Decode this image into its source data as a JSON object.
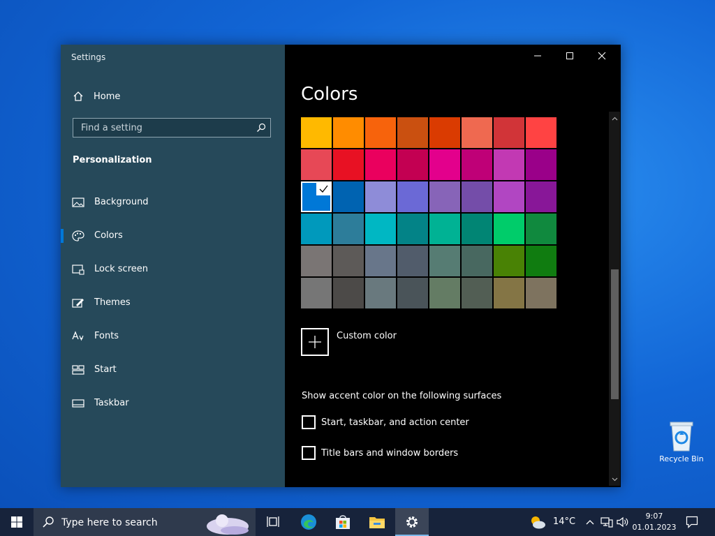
{
  "window": {
    "app_title": "Settings",
    "controls": {
      "minimize": "minimize",
      "maximize": "maximize",
      "close": "close"
    }
  },
  "sidebar": {
    "home_label": "Home",
    "search_placeholder": "Find a setting",
    "section_title": "Personalization",
    "items": [
      {
        "label": "Background",
        "icon": "picture-icon",
        "active": false
      },
      {
        "label": "Colors",
        "icon": "palette-icon",
        "active": true
      },
      {
        "label": "Lock screen",
        "icon": "lock-screen-icon",
        "active": false
      },
      {
        "label": "Themes",
        "icon": "themes-icon",
        "active": false
      },
      {
        "label": "Fonts",
        "icon": "fonts-icon",
        "active": false
      },
      {
        "label": "Start",
        "icon": "start-icon",
        "active": false
      },
      {
        "label": "Taskbar",
        "icon": "taskbar-icon",
        "active": false
      }
    ]
  },
  "main": {
    "title": "Colors",
    "selected_color": "#0078d7",
    "color_rows": [
      [
        "#ffb900",
        "#ff8c00",
        "#f7630c",
        "#ca5010",
        "#da3b01",
        "#ef6950",
        "#d13438",
        "#ff4343"
      ],
      [
        "#e74856",
        "#e81123",
        "#ea005e",
        "#c30052",
        "#e3008c",
        "#bf0077",
        "#c239b3",
        "#9a0089"
      ],
      [
        "#0078d7",
        "#0063b1",
        "#8e8cd8",
        "#6b69d6",
        "#8764b8",
        "#744da9",
        "#b146c2",
        "#881798"
      ],
      [
        "#0099bc",
        "#2d7d9a",
        "#00b7c3",
        "#038387",
        "#00b294",
        "#018574",
        "#00cc6a",
        "#10893e"
      ],
      [
        "#7a7574",
        "#5d5a58",
        "#68768a",
        "#515c6b",
        "#567c73",
        "#486860",
        "#498205",
        "#107c10"
      ],
      [
        "#767676",
        "#4c4a48",
        "#69797e",
        "#4a5459",
        "#647c64",
        "#525e54",
        "#847545",
        "#7e735f"
      ]
    ],
    "custom_color_label": "Custom color",
    "surfaces_heading": "Show accent color on the following surfaces",
    "checkboxes": [
      {
        "label": "Start, taskbar, and action center",
        "checked": false
      },
      {
        "label": "Title bars and window borders",
        "checked": false
      }
    ]
  },
  "desktop": {
    "recycle_bin_label": "Recycle Bin"
  },
  "taskbar": {
    "search_placeholder": "Type here to search",
    "temperature": "14°C",
    "time": "9:07",
    "date": "01.01.2023"
  }
}
